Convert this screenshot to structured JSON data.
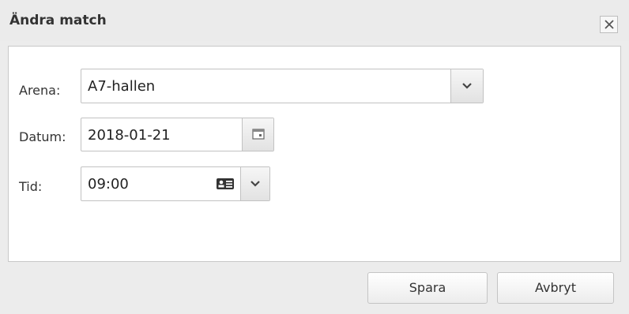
{
  "dialog": {
    "title": "Ändra match",
    "close_icon": "close-icon"
  },
  "form": {
    "arena": {
      "label": "Arena:",
      "value": "A7-hallen",
      "icon": "chevron-down-icon"
    },
    "datum": {
      "label": "Datum:",
      "value": "2018-01-21",
      "icon": "calendar-icon"
    },
    "tid": {
      "label": "Tid:",
      "value": "09:00",
      "icons": [
        "clock-list-icon",
        "chevron-down-icon"
      ]
    }
  },
  "footer": {
    "save_label": "Spara",
    "cancel_label": "Avbryt"
  },
  "colors": {
    "title_bar": "#ebebeb",
    "content_bg": "#ffffff",
    "border": "#c2c2c2",
    "text": "#333333"
  }
}
